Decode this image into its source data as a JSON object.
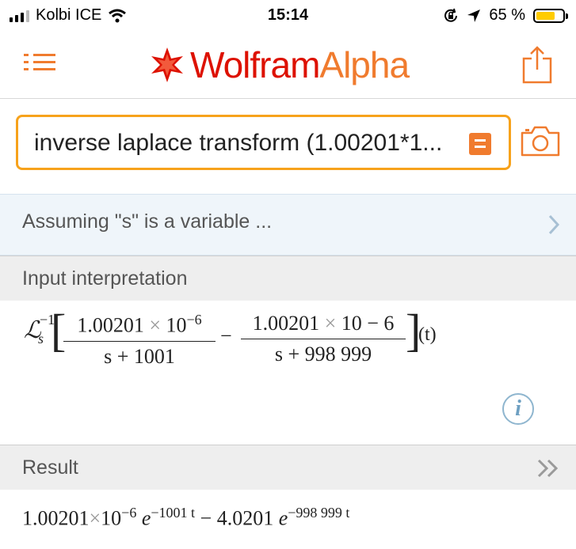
{
  "status_bar": {
    "carrier": "Kolbi ICE",
    "time": "15:14",
    "battery": "65 %",
    "battery_level": 0.65
  },
  "header": {
    "brand_part1": "Wolfram",
    "brand_part2": "Alpha"
  },
  "search": {
    "query": "inverse laplace transform (1.00201*1..."
  },
  "assumption": {
    "text": "Assuming \"s\" is a variable ..."
  },
  "pods": {
    "input": {
      "title": "Input interpretation",
      "operator": "ℒ",
      "operator_sub": "s",
      "operator_sup": "−1",
      "frac1_num_a": "1.00201",
      "frac1_num_times": "×",
      "frac1_num_b": "10",
      "frac1_num_exp": "−6",
      "frac1_den": "s + 1001",
      "minus": "−",
      "frac2_num_a": "1.00201",
      "frac2_num_times": "×",
      "frac2_num_b": "10 − 6",
      "frac2_den": "s + 998 999",
      "arg": "(t)",
      "info_symbol": "i"
    },
    "result": {
      "title": "Result",
      "coef1": "1.00201",
      "times": "×",
      "base1": "10",
      "exp1": "−6",
      "e": "e",
      "eexp1": "−1001 t",
      "minus": " − ",
      "coef2": "4.0201",
      "eexp2": "−998 999 t"
    }
  },
  "colors": {
    "accent": "#f07b2e",
    "brand_red": "#dd1100",
    "search_border": "#f7a21b",
    "info_blue": "#6ea0c2"
  },
  "icons": [
    "signal-icon",
    "wifi-icon",
    "rotation-lock-icon",
    "location-icon",
    "battery-icon",
    "menu-icon",
    "wolfram-spikey-icon",
    "share-icon",
    "keyboard-toggle-icon",
    "camera-icon",
    "chevron-right-icon",
    "double-chevron-icon",
    "info-icon"
  ]
}
